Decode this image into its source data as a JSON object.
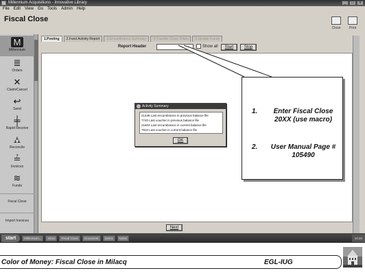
{
  "window": {
    "title": "Millennium Acquisitions - Innovative Library"
  },
  "menu": [
    "File",
    "Edit",
    "View",
    "Go",
    "Tools",
    "Admin",
    "Help"
  ],
  "screen_title": "Fiscal Close",
  "top_tools": [
    {
      "label": "Close",
      "icon": "close-door-icon"
    },
    {
      "label": "Print",
      "icon": "printer-icon"
    }
  ],
  "sidebar": [
    {
      "label": "Millennium",
      "icon": "millennium-m-icon",
      "selected": true
    },
    {
      "label": "Orders",
      "icon": "orders-icon"
    },
    {
      "label": "Claim/Cancel",
      "icon": "claim-cancel-icon"
    },
    {
      "label": "Send",
      "icon": "send-arrow-icon"
    },
    {
      "label": "Rapid Receive",
      "icon": "rapid-receive-icon"
    },
    {
      "label": "Reconcile",
      "icon": "reconcile-icon"
    },
    {
      "label": "Invoices",
      "icon": "invoices-icon"
    },
    {
      "label": "Funds",
      "icon": "funds-icon"
    },
    {
      "label": "Fiscal Close",
      "icon": ""
    },
    {
      "label": "Import Invoices",
      "icon": ""
    }
  ],
  "tabs": [
    {
      "label": "1.Posting",
      "state": "active"
    },
    {
      "label": "2.Fund Activity Report",
      "state": "normal"
    },
    {
      "label": "3.Encumbrance Summary",
      "state": "disabled"
    },
    {
      "label": "4.Transfer Close Totals",
      "state": "disabled"
    },
    {
      "label": "5.Update Funds",
      "state": "disabled"
    }
  ],
  "report": {
    "label": "Report Header",
    "input_value": "",
    "show_all_label": "Show all",
    "start_label": "Start",
    "stop_label": "Stop"
  },
  "next_label": "Next",
  "dialog": {
    "title": "Activity Summary",
    "lines": [
      "21448 Last encumbrance in previous balance file",
      "7740 Last voucher in previous balance file",
      "21603 Last encumbrance in current balance file",
      "7810 Last voucher in current balance file"
    ],
    "ok_label": "OK"
  },
  "taskbar": {
    "start_label": "start",
    "items": [
      "Millennium...",
      "Inbox",
      "Fiscal Close",
      "Document",
      "Sierra",
      "Notes"
    ],
    "clock": "10:26"
  },
  "callout": {
    "items": [
      {
        "num": "1.",
        "text": "Enter Fiscal Close 20XX (use macro)"
      },
      {
        "num": "2.",
        "text": "User Manual Page # 105490"
      }
    ]
  },
  "footer": {
    "title": "Color of Money: Fiscal Close in Milacq",
    "org": "EGL-IUG"
  }
}
